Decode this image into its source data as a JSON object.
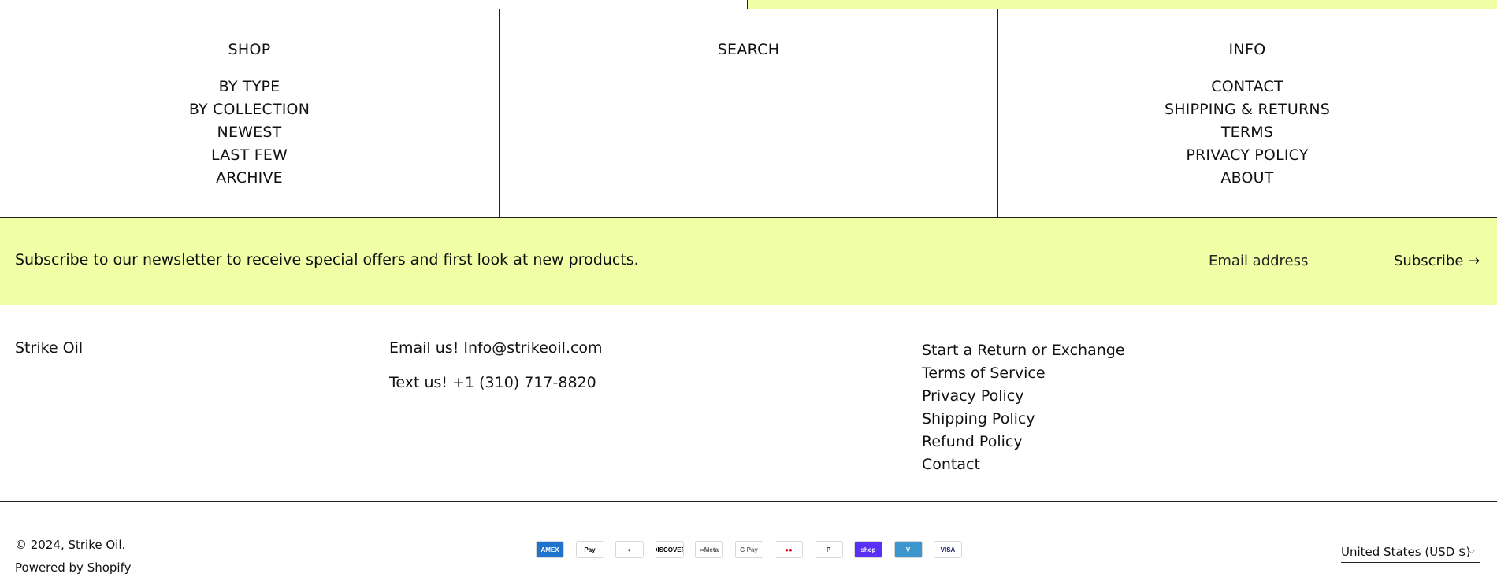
{
  "menu": {
    "shop": {
      "title": "SHOP",
      "items": [
        "BY TYPE",
        "BY COLLECTION",
        "NEWEST",
        "LAST FEW",
        "ARCHIVE"
      ]
    },
    "search": {
      "title": "SEARCH"
    },
    "info": {
      "title": "INFO",
      "items": [
        "CONTACT",
        "SHIPPING & RETURNS",
        "TERMS",
        "PRIVACY POLICY",
        "ABOUT"
      ]
    }
  },
  "newsletter": {
    "message": "Subscribe to our newsletter to receive special offers and first look at new products.",
    "email_placeholder": "Email address",
    "subscribe_label": "Subscribe →",
    "background_color": "#f0fea6"
  },
  "footer": {
    "brand": "Strike Oil",
    "email_line": "Email us! Info@strikeoil.com",
    "text_line": "Text us! +1 (310) 717-8820",
    "policies": [
      "Start a Return or Exchange",
      "Terms of Service",
      "Privacy Policy",
      "Shipping Policy",
      "Refund Policy",
      "Contact"
    ]
  },
  "bottom": {
    "copyright": "© 2024, Strike Oil.",
    "powered_by": "Powered by Shopify",
    "payment_methods": [
      {
        "name": "american-express-icon",
        "label": "AMEX",
        "bg": "#1f72cd",
        "fg": "#ffffff"
      },
      {
        "name": "apple-pay-icon",
        "label": " Pay",
        "bg": "#ffffff",
        "fg": "#000000"
      },
      {
        "name": "diners-club-icon",
        "label": "◐",
        "bg": "#ffffff",
        "fg": "#0079be"
      },
      {
        "name": "discover-icon",
        "label": "DISCOVER",
        "bg": "#ffffff",
        "fg": "#000000"
      },
      {
        "name": "meta-pay-icon",
        "label": "∞Meta",
        "bg": "#ffffff",
        "fg": "#555555"
      },
      {
        "name": "google-pay-icon",
        "label": "G Pay",
        "bg": "#ffffff",
        "fg": "#5f6368"
      },
      {
        "name": "mastercard-icon",
        "label": "●●",
        "bg": "#ffffff",
        "fg": "#eb001b"
      },
      {
        "name": "paypal-icon",
        "label": "P",
        "bg": "#ffffff",
        "fg": "#003087"
      },
      {
        "name": "shop-pay-icon",
        "label": "shop",
        "bg": "#5a31f4",
        "fg": "#ffffff"
      },
      {
        "name": "venmo-icon",
        "label": "V",
        "bg": "#3d95ce",
        "fg": "#ffffff"
      },
      {
        "name": "visa-icon",
        "label": "VISA",
        "bg": "#ffffff",
        "fg": "#1a1f71"
      }
    ],
    "currency": "United States (USD $)"
  }
}
